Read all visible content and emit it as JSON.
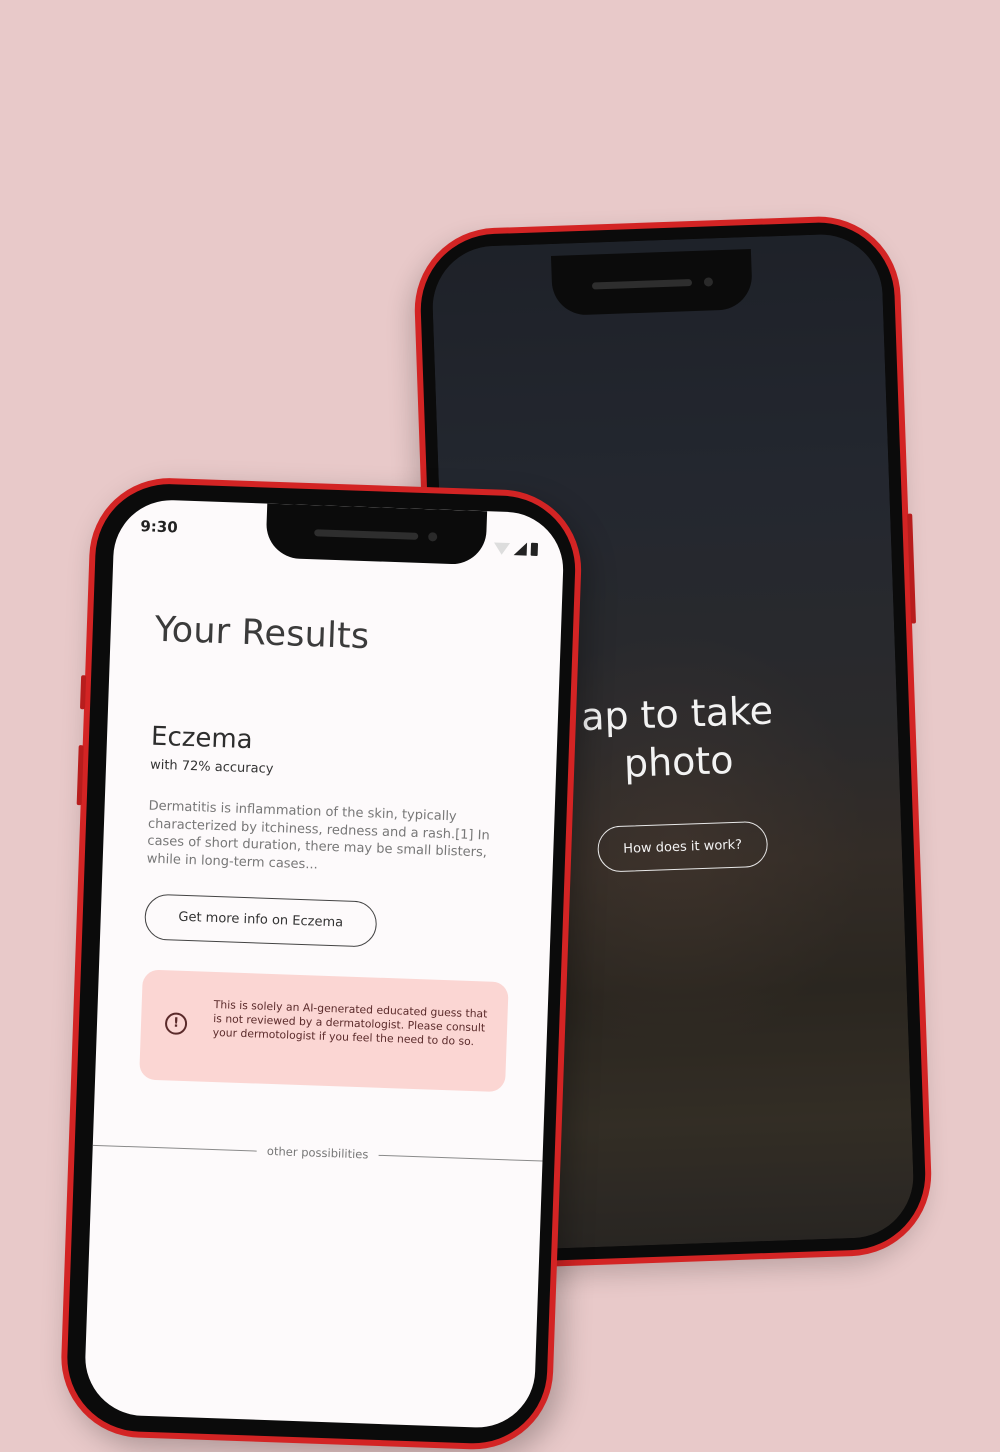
{
  "camera_screen": {
    "title_line1": "ap to take",
    "title_line2": "photo",
    "how_button": "How does it work?"
  },
  "results_screen": {
    "status": {
      "time": "9:30"
    },
    "title": "Your Results",
    "condition": {
      "name": "Eczema",
      "accuracy": "with 72% accuracy",
      "description": "Dermatitis is inflammation of the skin, typically characterized by itchiness, redness and a rash.[1] In cases of short duration, there may be small blisters, while in long-term cases..."
    },
    "more_info_button": "Get more info on Eczema",
    "disclaimer": {
      "icon": "!",
      "text": "This is solely an AI-generated educated guess that is not reviewed by a dermatologist. Please consult your dermotologist if you feel the need to do so."
    },
    "other_possibilities_label": "other possibilities"
  },
  "colors": {
    "background": "#e8c9c9",
    "phone_frame": "#d32424",
    "disclaimer_bg": "#fbd6d3"
  }
}
